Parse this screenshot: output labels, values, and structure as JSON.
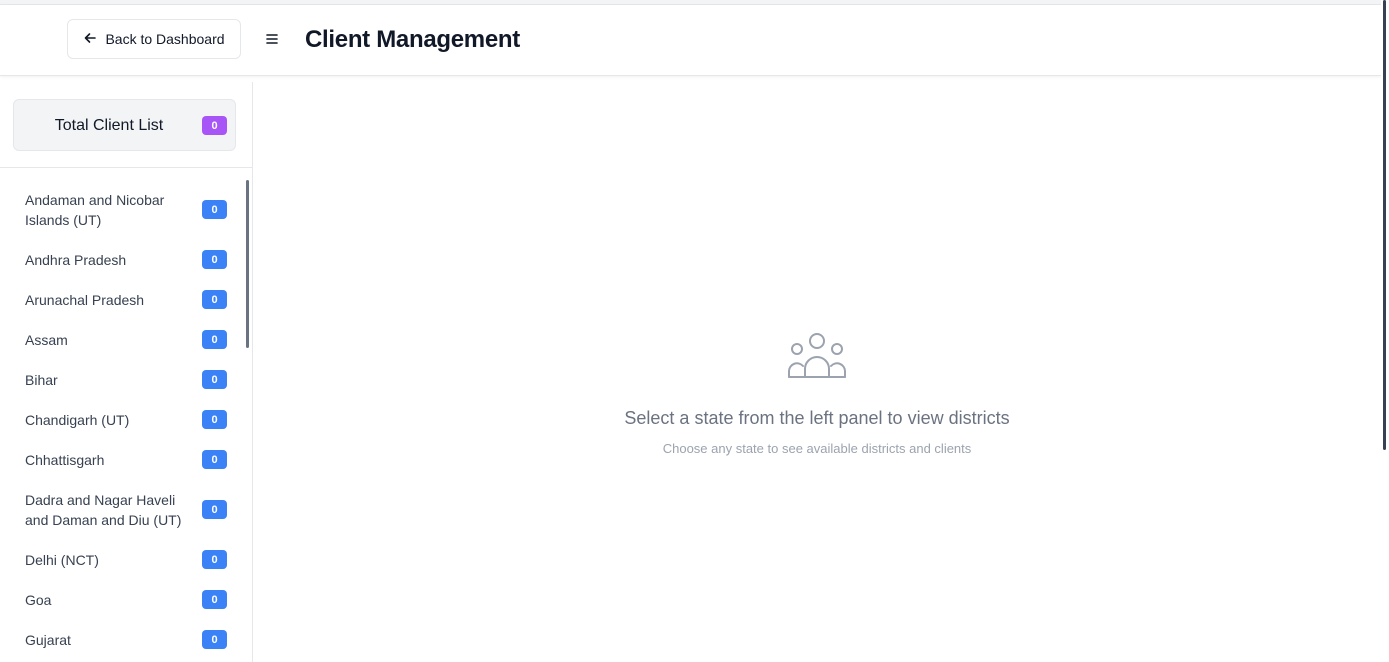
{
  "header": {
    "back_label": "Back to Dashboard",
    "title": "Client Management"
  },
  "sidebar": {
    "total_label": "Total Client List",
    "total_count": "0",
    "states": [
      {
        "name": "Andaman and Nicobar Islands (UT)",
        "count": "0"
      },
      {
        "name": "Andhra Pradesh",
        "count": "0"
      },
      {
        "name": "Arunachal Pradesh",
        "count": "0"
      },
      {
        "name": "Assam",
        "count": "0"
      },
      {
        "name": "Bihar",
        "count": "0"
      },
      {
        "name": "Chandigarh (UT)",
        "count": "0"
      },
      {
        "name": "Chhattisgarh",
        "count": "0"
      },
      {
        "name": "Dadra and Nagar Haveli and Daman and Diu (UT)",
        "count": "0"
      },
      {
        "name": "Delhi (NCT)",
        "count": "0"
      },
      {
        "name": "Goa",
        "count": "0"
      },
      {
        "name": "Gujarat",
        "count": "0"
      }
    ]
  },
  "empty_state": {
    "icon": "users-icon",
    "title": "Select a state from the left panel to view districts",
    "subtitle": "Choose any state to see available districts and clients"
  },
  "colors": {
    "total_badge": "#a855f7",
    "state_badge": "#3b82f6"
  }
}
